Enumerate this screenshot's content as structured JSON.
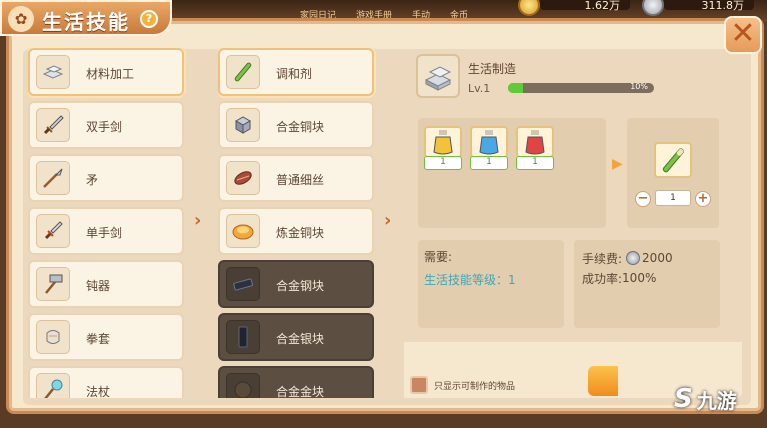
{
  "hud": {
    "tabs": [
      "家园日记",
      "游戏手册",
      "手动",
      "金币"
    ],
    "gold": "1.62万",
    "silver": "311.8万"
  },
  "title": "生活技能",
  "help": "?",
  "close": "✕",
  "categories": [
    {
      "label": "材料加工",
      "icon": "ingot-icon",
      "active": true
    },
    {
      "label": "双手剑",
      "icon": "greatsword-icon",
      "active": false
    },
    {
      "label": "矛",
      "icon": "spear-icon",
      "active": false
    },
    {
      "label": "单手剑",
      "icon": "sword-icon",
      "active": false
    },
    {
      "label": "钝器",
      "icon": "hammer-icon",
      "active": false
    },
    {
      "label": "拳套",
      "icon": "gauntlet-icon",
      "active": false
    },
    {
      "label": "法杖",
      "icon": "staff-icon",
      "active": false
    }
  ],
  "recipes": [
    {
      "label": "调和剂",
      "icon": "reagent-icon",
      "state": "active"
    },
    {
      "label": "合金铜块",
      "icon": "alloy-cube-icon",
      "state": "normal"
    },
    {
      "label": "普通细丝",
      "icon": "thread-icon",
      "state": "normal"
    },
    {
      "label": "炼金铜块",
      "icon": "gold-ore-icon",
      "state": "normal"
    },
    {
      "label": "合金钢块",
      "icon": "steel-bar-icon",
      "state": "locked"
    },
    {
      "label": "合金银块",
      "icon": "silver-bar-icon",
      "state": "locked"
    },
    {
      "label": "合金金块",
      "icon": "gold-bar-icon",
      "state": "locked"
    }
  ],
  "detail": {
    "name": "生活制造",
    "level": "Lv.1",
    "progress": 0.1,
    "progress_text": "10%",
    "materials": [
      {
        "icon": "yellow-potion-icon",
        "color": "#f2c23a",
        "qty": "1"
      },
      {
        "icon": "blue-potion-icon",
        "color": "#4aa8e6",
        "qty": "1"
      },
      {
        "icon": "red-potion-icon",
        "color": "#e04444",
        "qty": "1"
      }
    ],
    "output_icon": "reagent-icon",
    "quantity": "1",
    "requirement_title": "需要:",
    "requirement_line": "生活技能等级：1",
    "fee_label": "手续费:",
    "fee_value": "2000",
    "success_label": "成功率:",
    "success_value": "100%"
  },
  "filter_label": "只显示可制作的物品",
  "watermark": {
    "logo": "S",
    "text": "九游"
  }
}
